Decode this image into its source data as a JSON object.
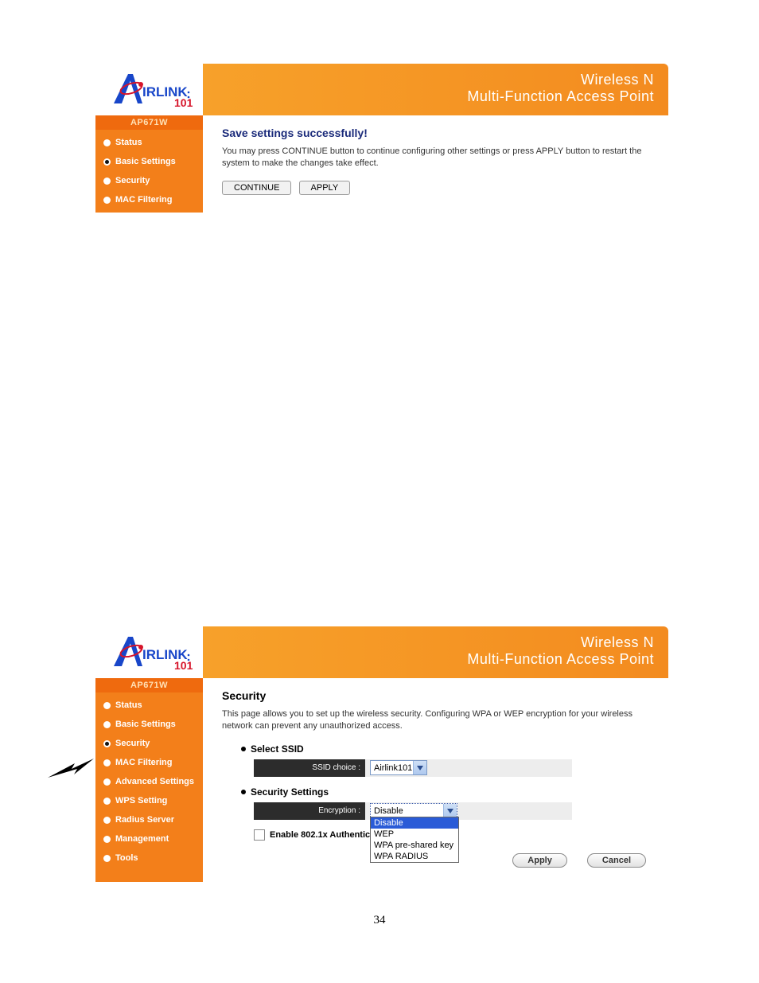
{
  "page_number": "34",
  "brand": {
    "line1": "Wireless N",
    "line2": "Multi-Function Access Point"
  },
  "shot1": {
    "model": "AP671W",
    "nav": [
      {
        "label": "Status",
        "selected": false
      },
      {
        "label": "Basic Settings",
        "selected": true
      },
      {
        "label": "Security",
        "selected": false
      },
      {
        "label": "MAC Filtering",
        "selected": false
      }
    ],
    "title": "Save settings successfully!",
    "desc": "You may press CONTINUE button to continue configuring other settings or press APPLY button to restart the system to make the changes take effect.",
    "btn_continue": "CONTINUE",
    "btn_apply": "APPLY"
  },
  "shot2": {
    "model": "AP671W",
    "nav": [
      {
        "label": "Status",
        "selected": false
      },
      {
        "label": "Basic Settings",
        "selected": false
      },
      {
        "label": "Security",
        "selected": true
      },
      {
        "label": "MAC Filtering",
        "selected": false
      },
      {
        "label": "Advanced Settings",
        "selected": false
      },
      {
        "label": "WPS Setting",
        "selected": false
      },
      {
        "label": "Radius Server",
        "selected": false
      },
      {
        "label": "Management",
        "selected": false
      },
      {
        "label": "Tools",
        "selected": false
      }
    ],
    "title": "Security",
    "desc": "This page allows you to set up the wireless security. Configuring WPA or WEP encryption for your wireless network can prevent any unauthorized access.",
    "section_ssid": "Select SSID",
    "ssid_label": "SSID choice :",
    "ssid_value": "Airlink101",
    "section_sec": "Security Settings",
    "enc_label": "Encryption :",
    "enc_value": "Disable",
    "enc_options": [
      "Disable",
      "WEP",
      "WPA pre-shared key",
      "WPA RADIUS"
    ],
    "chk_label": "Enable 802.1x Authentication",
    "btn_apply": "Apply",
    "btn_cancel": "Cancel"
  }
}
